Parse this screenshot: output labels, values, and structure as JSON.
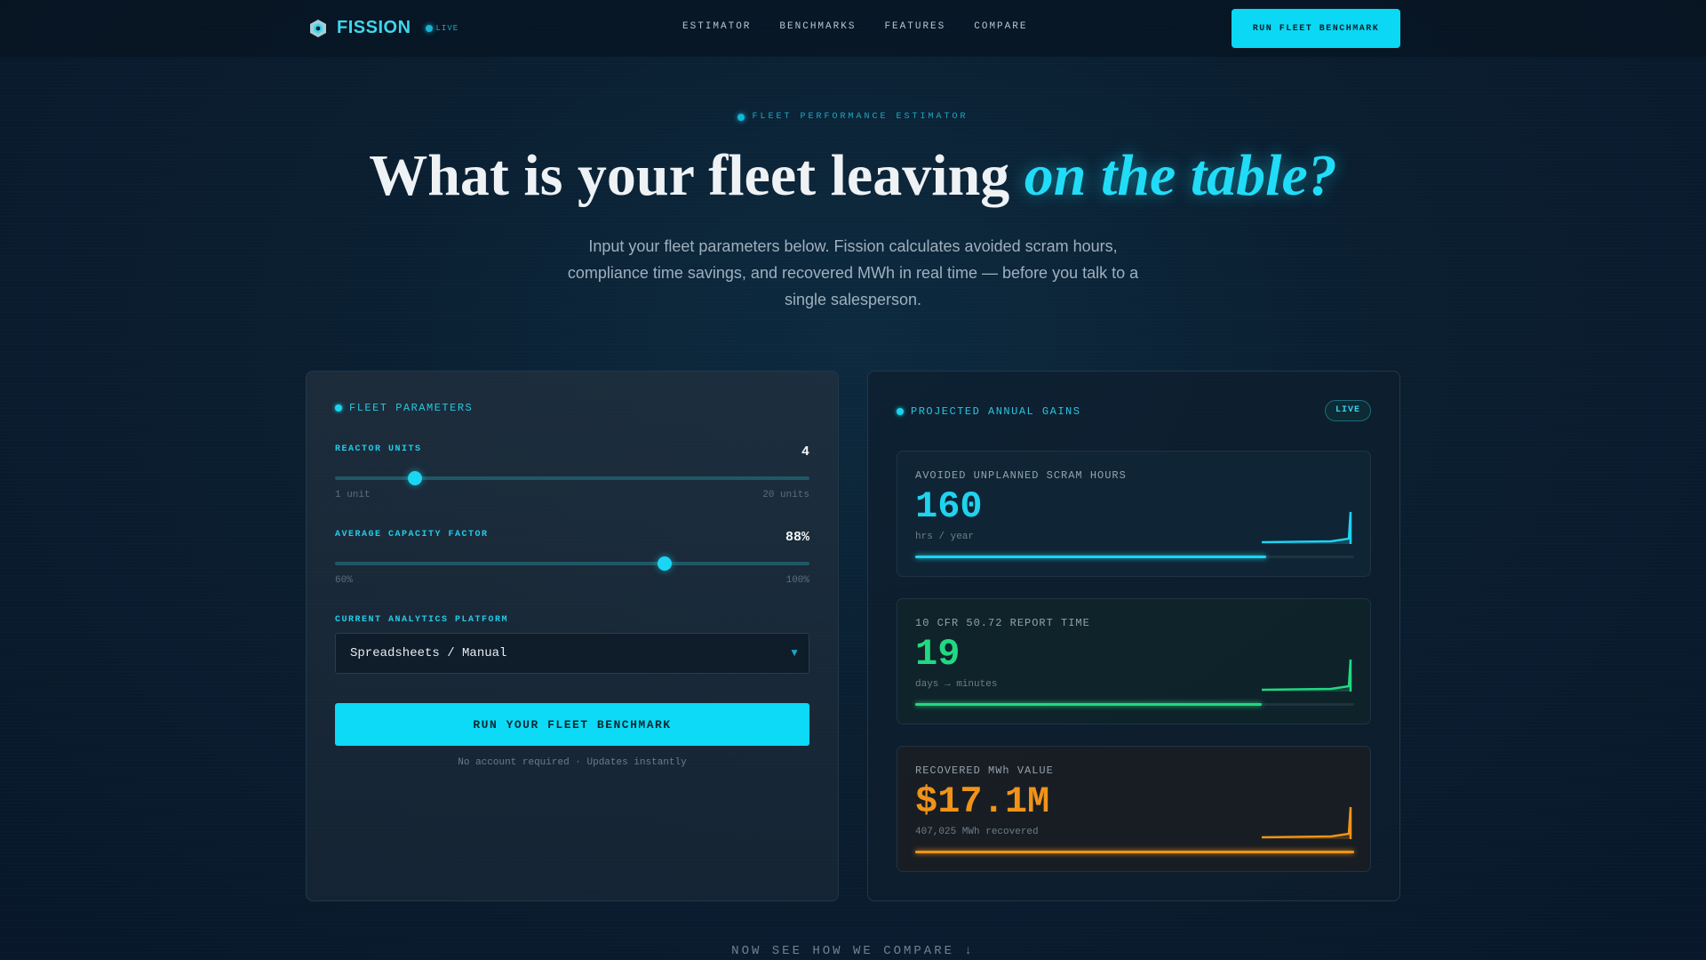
{
  "nav": {
    "brand": "FISSION",
    "live": "LIVE",
    "links": [
      "ESTIMATOR",
      "BENCHMARKS",
      "FEATURES",
      "COMPARE"
    ],
    "cta": "RUN FLEET BENCHMARK"
  },
  "hero": {
    "eyebrow": "FLEET PERFORMANCE ESTIMATOR",
    "headline_plain": "What is your fleet leaving ",
    "headline_accent": "on the table?",
    "subtitle": "Input your fleet parameters below. Fission calculates avoided scram hours, compliance time savings, and recovered MWh in real time — before you talk to a single salesperson."
  },
  "params": {
    "title": "FLEET PARAMETERS",
    "reactor_units": {
      "label": "REACTOR UNITS",
      "value": "4",
      "min": "1 unit",
      "max": "20 units",
      "level": 0.168
    },
    "capacity_factor": {
      "label": "AVERAGE CAPACITY FACTOR",
      "value": "88%",
      "min": "60%",
      "max": "100%",
      "level": 0.695
    },
    "platform": {
      "label": "CURRENT ANALYTICS PLATFORM",
      "selected": "Spreadsheets / Manual"
    },
    "button": "RUN YOUR FLEET BENCHMARK",
    "note": "No account required · Updates instantly"
  },
  "gains": {
    "title": "PROJECTED ANNUAL GAINS",
    "badge": "LIVE",
    "metrics": [
      {
        "label": "AVOIDED UNPLANNED SCRAM HOURS",
        "value": "160",
        "unit": "hrs / year",
        "color": "#1fd3f0",
        "progress": 0.8
      },
      {
        "label": "10 CFR 50.72 REPORT TIME",
        "value": "19",
        "unit": "days → minutes",
        "color": "#22d882",
        "progress": 0.79
      },
      {
        "label": "RECOVERED MWh VALUE",
        "value": "$17.1M",
        "unit": "407,025 MWh recovered",
        "color": "#f19318",
        "progress": 1.0
      }
    ]
  },
  "footer": {
    "compare": "NOW SEE HOW WE COMPARE ↓"
  }
}
